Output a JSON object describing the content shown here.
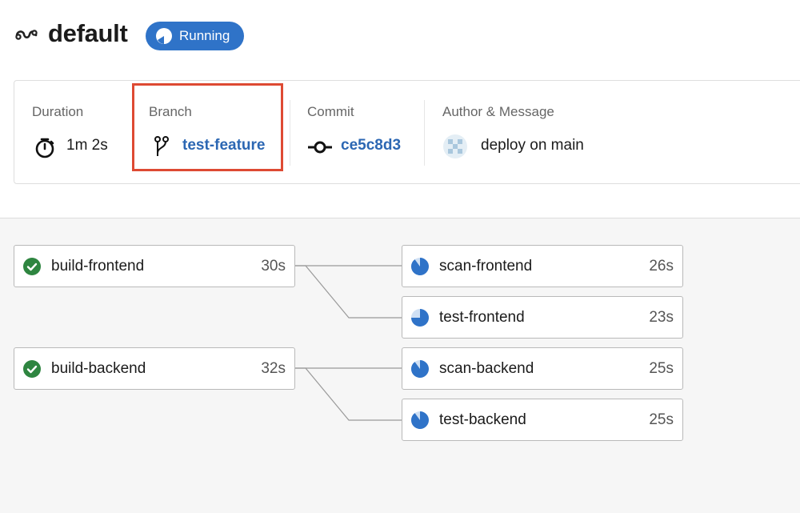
{
  "header": {
    "title": "default",
    "status_badge": "Running",
    "icon": "pipeline-icon"
  },
  "info": {
    "duration_label": "Duration",
    "duration_value": "1m 2s",
    "branch_label": "Branch",
    "branch_value": "test-feature",
    "commit_label": "Commit",
    "commit_value": "ce5c8d3",
    "author_label": "Author & Message",
    "message": "deploy on main"
  },
  "stages": {
    "build": [
      {
        "name": "build-frontend",
        "time": "30s",
        "status": "success"
      },
      {
        "name": "build-backend",
        "time": "32s",
        "status": "success"
      }
    ],
    "downstream": [
      {
        "name": "scan-frontend",
        "time": "26s",
        "status": "running",
        "progress": 0.85
      },
      {
        "name": "test-frontend",
        "time": "23s",
        "status": "running",
        "progress": 0.75
      },
      {
        "name": "scan-backend",
        "time": "25s",
        "status": "running",
        "progress": 0.85
      },
      {
        "name": "test-backend",
        "time": "25s",
        "status": "running",
        "progress": 0.85
      }
    ]
  },
  "colors": {
    "accent": "#2f73c8",
    "link": "#2c67b3",
    "success": "#2e8540",
    "highlight": "#de4a33"
  }
}
